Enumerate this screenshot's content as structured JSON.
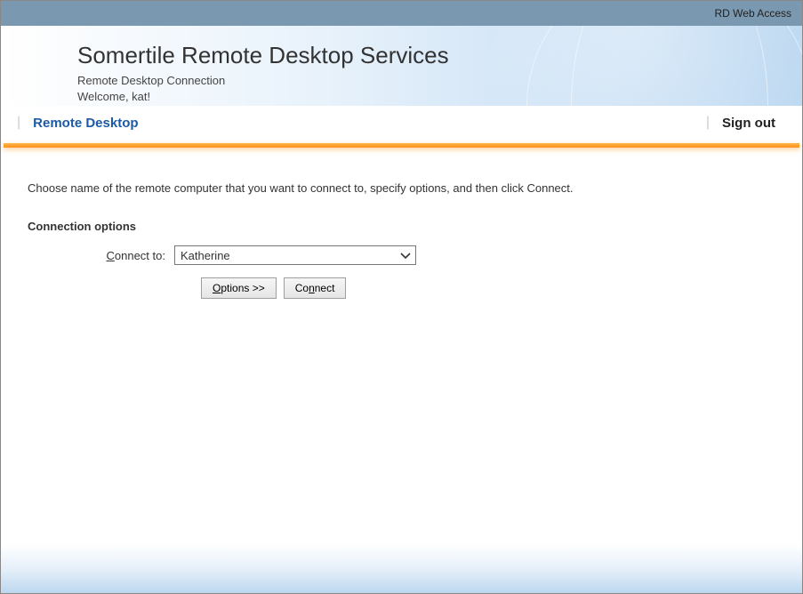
{
  "top_bar": {
    "title": "RD Web Access"
  },
  "banner": {
    "title": "Somertile Remote Desktop Services",
    "subtitle1": "Remote Desktop Connection",
    "subtitle2": "Welcome, kat!"
  },
  "nav": {
    "active_tab": "Remote Desktop",
    "sign_out": "Sign out"
  },
  "content": {
    "instruction": "Choose name of the remote computer that you want to connect to, specify options, and then click Connect.",
    "section_title": "Connection options",
    "connect_to_label": "Connect to:",
    "connect_to_value": "Katherine",
    "options_button": "Options >>",
    "connect_button": "Connect"
  }
}
